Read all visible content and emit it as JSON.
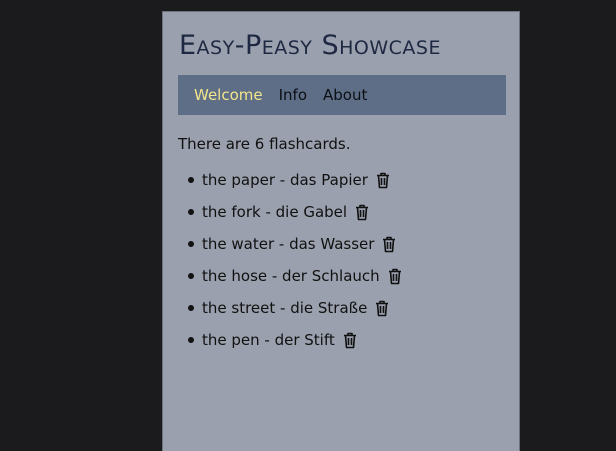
{
  "app": {
    "title": "Easy-Peasy Showcase"
  },
  "nav": {
    "items": [
      {
        "label": "Welcome",
        "active": true
      },
      {
        "label": "Info",
        "active": false
      },
      {
        "label": "About",
        "active": false
      }
    ]
  },
  "main": {
    "count_text": "There are 6 flashcards.",
    "flashcards": [
      {
        "label": "the paper - das Papier",
        "icon": "trash-icon"
      },
      {
        "label": "the fork - die Gabel",
        "icon": "trash-icon"
      },
      {
        "label": "the water - das Wasser",
        "icon": "trash-icon"
      },
      {
        "label": "the hose - der Schlauch",
        "icon": "trash-icon"
      },
      {
        "label": "the street - die Straße",
        "icon": "trash-icon"
      },
      {
        "label": "the pen - der Stift",
        "icon": "trash-icon"
      }
    ]
  },
  "colors": {
    "background": "#1b1b1d",
    "panel": "#9aa0ad",
    "nav_bar": "#5e6e87",
    "active_link": "#f2e58c",
    "title": "#1e2842"
  }
}
